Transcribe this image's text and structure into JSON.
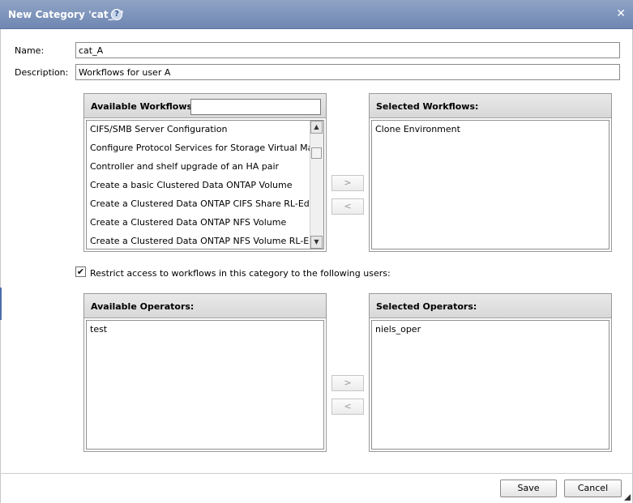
{
  "dialog": {
    "title": "New Category 'cat_A'",
    "help_icon": "help-icon",
    "close_icon": "close-icon"
  },
  "form": {
    "name_label": "Name:",
    "name_value": "cat_A",
    "description_label": "Description:",
    "description_value": "Workflows for user A"
  },
  "workflows": {
    "available_header": "Available Workflows:",
    "filter_value": "",
    "available_items": [
      "CIFS/SMB  Server Configuration",
      "Configure Protocol Services for Storage Virtual Machine",
      "Controller and shelf upgrade of an HA pair",
      "Create a basic Clustered Data ONTAP Volume",
      "Create a Clustered Data ONTAP CIFS Share RL-Edit",
      "Create a Clustered Data ONTAP NFS Volume",
      "Create a Clustered Data ONTAP NFS Volume RL-Edit"
    ],
    "selected_header": "Selected Workflows:",
    "selected_items": [
      "Clone Environment"
    ],
    "add_label": ">",
    "remove_label": "<"
  },
  "restrict": {
    "checked": true,
    "check_mark": "✔",
    "label": "Restrict access to workflows in this category to the following users:"
  },
  "operators": {
    "available_header": "Available Operators:",
    "available_items": [
      "test"
    ],
    "selected_header": "Selected Operators:",
    "selected_items": [
      "niels_oper"
    ],
    "add_label": ">",
    "remove_label": "<"
  },
  "footer": {
    "save_label": "Save",
    "cancel_label": "Cancel"
  },
  "scrollbar": {
    "up_arrow": "▲",
    "down_arrow": "▼"
  }
}
